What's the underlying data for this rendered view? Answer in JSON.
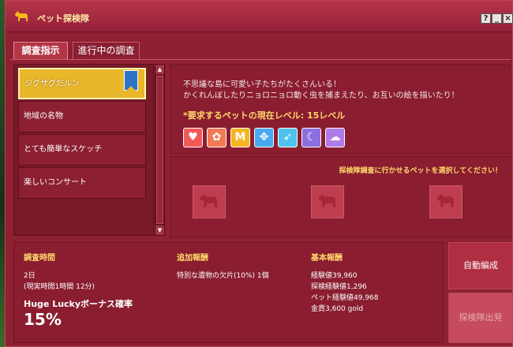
{
  "window": {
    "title": "ペット探検隊"
  },
  "tabs": [
    "調査指示",
    "進行中の調査"
  ],
  "list_items": [
    {
      "label": "ジグザグだルン"
    },
    {
      "label": "地域の名物"
    },
    {
      "label": "とても簡単なスケッチ"
    },
    {
      "label": "楽しいコンサート"
    }
  ],
  "description": {
    "line1": "不思議な島に可愛い子たちがたくさんいる！",
    "line2": "かくれんぼしたりニョロニョロ動く虫を捕まえたり、お互いの絵を描いたり！",
    "requirement": "*要求するペットの現在レベル: 15レベル"
  },
  "pet_types": [
    {
      "icon": "heart-icon",
      "glyph": "♥",
      "color": "#f25a5a"
    },
    {
      "icon": "flower-icon",
      "glyph": "✿",
      "color": "#f27a55"
    },
    {
      "icon": "m-icon",
      "glyph": "M",
      "color": "#f5b521"
    },
    {
      "icon": "paw-icon",
      "glyph": "✥",
      "color": "#49a9f0"
    },
    {
      "icon": "wing-icon",
      "glyph": "➶",
      "color": "#4ec3f0"
    },
    {
      "icon": "seal-icon",
      "glyph": "☾",
      "color": "#8b6fe0"
    },
    {
      "icon": "cloud-icon",
      "glyph": "☁",
      "color": "#b07be8"
    }
  ],
  "pick": {
    "instruction": "探検隊調査に行かせるペットを選択してください！"
  },
  "time": {
    "heading": "調査時間",
    "value": "2日",
    "real": "(現実時間1時間 12分)",
    "huge_label": "Huge Luckyボーナス確率",
    "huge_value": "15%"
  },
  "extra": {
    "heading": "追加報酬",
    "item": "特別な遺物の欠片(10%) 1個"
  },
  "basic": {
    "heading": "基本報酬",
    "lines": [
      "経験値39,960",
      "探検経験値1,296",
      "ペット経験値49,968",
      "金貨3,600 gold"
    ]
  },
  "buttons": {
    "auto": "自動編成",
    "go": "探検隊出発"
  },
  "window_buttons": {
    "help": "?",
    "min": "_",
    "close": "×"
  }
}
